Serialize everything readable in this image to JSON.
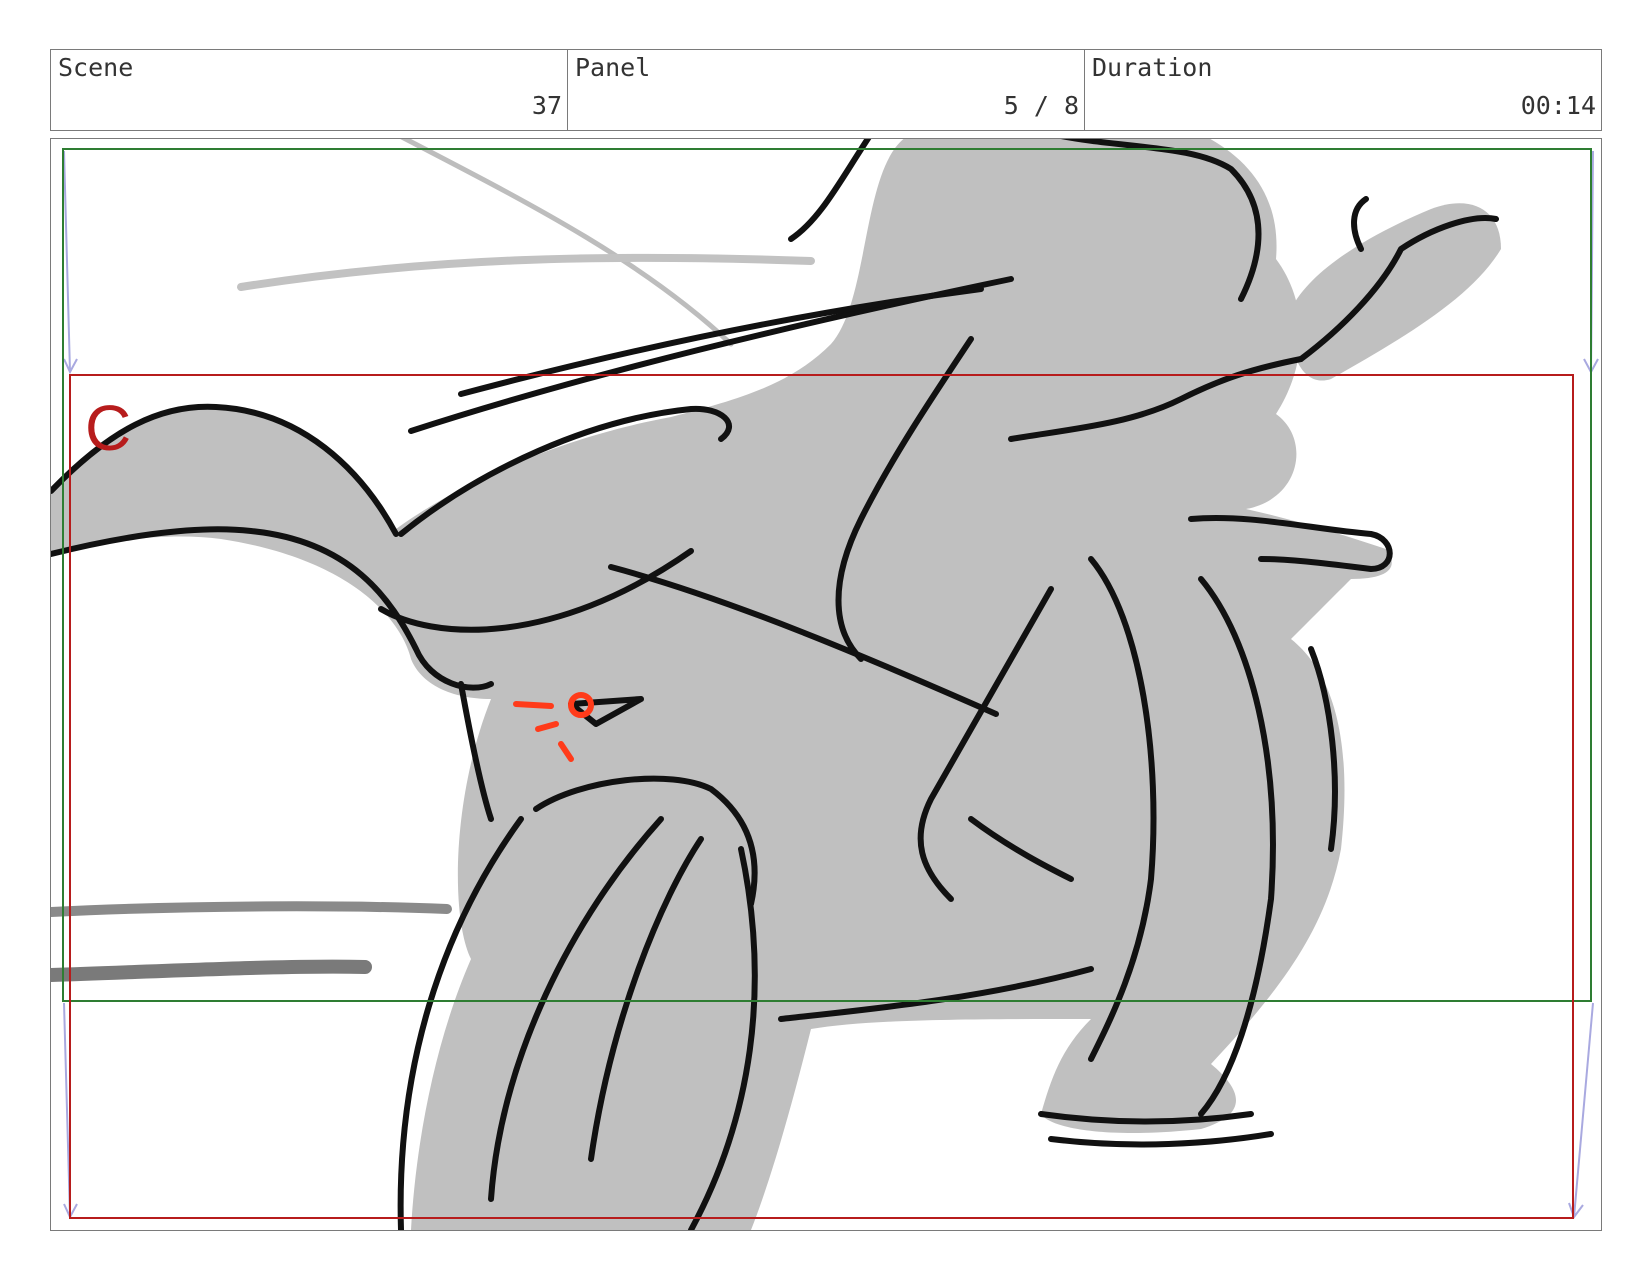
{
  "header": {
    "scene_label": "Scene",
    "scene_value": "37",
    "panel_label": "Panel",
    "panel_value": "5 / 8",
    "duration_label": "Duration",
    "duration_value": "00:14"
  },
  "panel": {
    "camera_label": "C"
  },
  "colors": {
    "safe_area_guide": "#2e7d32",
    "camera_guide": "#b71c1c",
    "camera_move_arrows": "#a9a9e0",
    "figure_fill": "#c0c0c0",
    "sketch_line": "#111111",
    "accent_mark": "#ff3b1a"
  }
}
